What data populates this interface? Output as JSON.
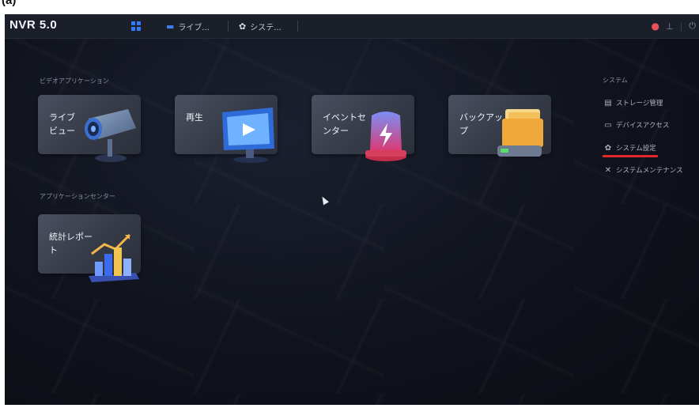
{
  "figure_label": "(a)",
  "topbar": {
    "logo": "NVR 5.0",
    "tabs": [
      {
        "label": "ライブ..."
      },
      {
        "label": "システ..."
      }
    ]
  },
  "sections": {
    "video_apps_title": "ビデオアプリケーション",
    "app_center_title": "アプリケーションセンター"
  },
  "cards": {
    "live": "ライブ\nビュー",
    "playback": "再生",
    "event": "イベントセ\nンター",
    "backup": "バックアッ\nプ",
    "stats": "統計レポー\nト"
  },
  "right_panel": {
    "title": "システム",
    "items": [
      {
        "label": "ストレージ管理",
        "icon": "storage-icon"
      },
      {
        "label": "デバイスアクセス",
        "icon": "device-icon"
      },
      {
        "label": "システム設定",
        "icon": "gear-icon"
      },
      {
        "label": "システムメンテナンス",
        "icon": "wrench-icon"
      }
    ],
    "highlight_color": "#e0282e"
  },
  "colors": {
    "accent": "#2f7cf6",
    "alarm": "#e8505b"
  }
}
